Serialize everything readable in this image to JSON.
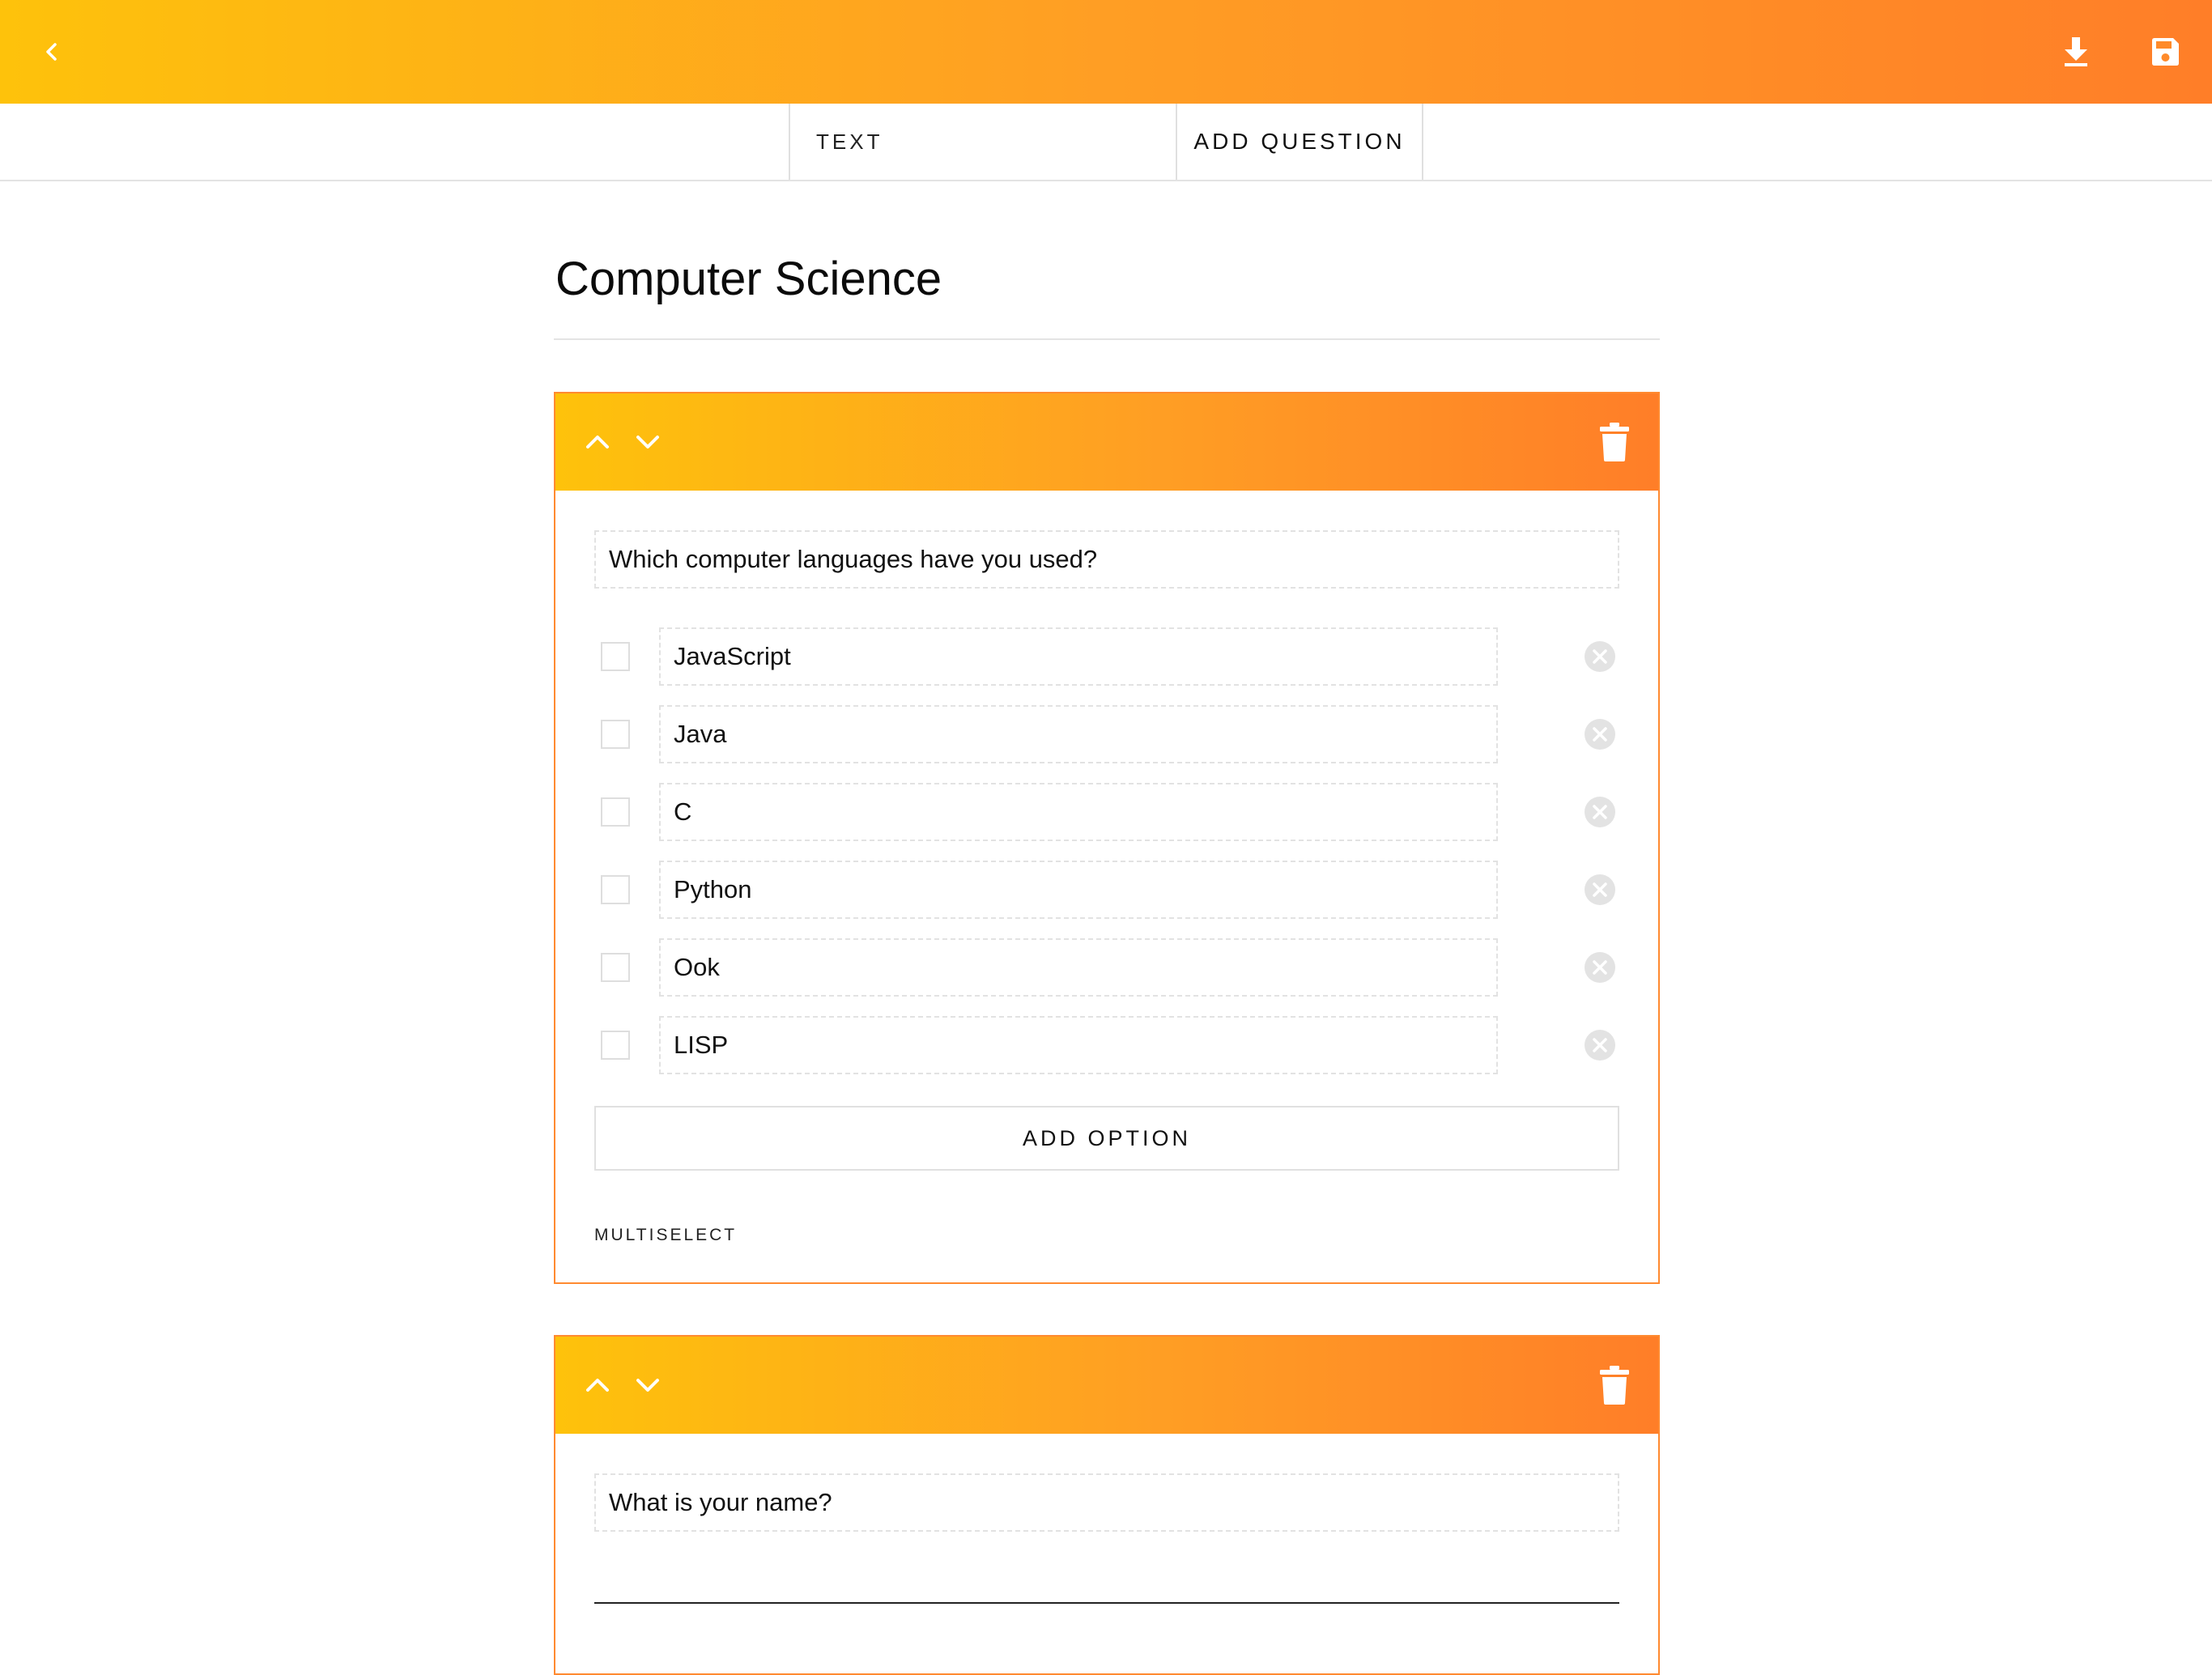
{
  "colors": {
    "accent_start": "#FEC20B",
    "accent_end": "#FF7E28",
    "card_border": "#FF8A30"
  },
  "topbar": {
    "back_icon": "chevron-left-icon",
    "download_icon": "download-icon",
    "save_icon": "floppy-disk-icon"
  },
  "toolbar": {
    "text_label": "TEXT",
    "add_question_label": "ADD QUESTION"
  },
  "form": {
    "title": "Computer Science"
  },
  "questions": [
    {
      "text": "Which computer languages have you used?",
      "type_label": "MULTISELECT",
      "options": [
        "JavaScript",
        "Java",
        "C",
        "Python",
        "Ook",
        "LISP"
      ],
      "add_option_label": "ADD OPTION"
    },
    {
      "text": "What is your name?"
    }
  ]
}
